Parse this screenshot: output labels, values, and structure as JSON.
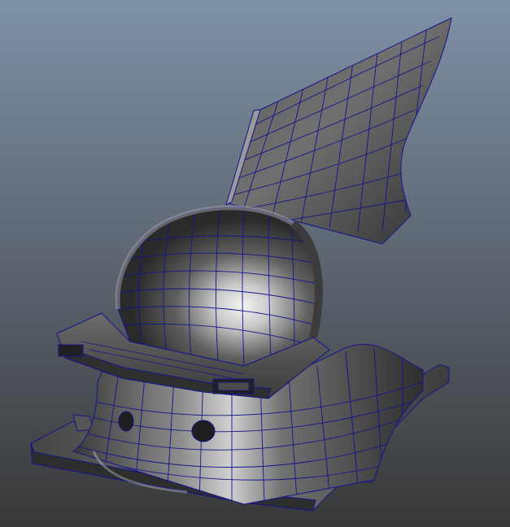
{
  "viewport": {
    "background_top": "#7f91a7",
    "background_bottom": "#383838"
  },
  "model": {
    "surface_light": "#c9c9c9",
    "surface_mid": "#6d6d6d",
    "surface_dark": "#2e2e2e",
    "wireframe_color": "#14148c",
    "interior_highlight": "#f4f4f4"
  }
}
